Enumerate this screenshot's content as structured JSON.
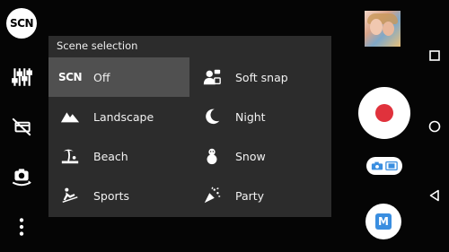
{
  "left_rail": {
    "scn_badge": "SCN",
    "icons": [
      "settings-sliders-icon",
      "flash-off-icon",
      "switch-camera-icon",
      "more-options-icon"
    ]
  },
  "scene_panel": {
    "title": "Scene selection",
    "selected": "Off",
    "items": [
      {
        "label": "Off",
        "icon": "scn-text-icon",
        "icon_text": "SCN"
      },
      {
        "label": "Soft snap",
        "icon": "soft-snap-icon"
      },
      {
        "label": "Landscape",
        "icon": "landscape-icon"
      },
      {
        "label": "Night",
        "icon": "night-icon"
      },
      {
        "label": "Beach",
        "icon": "beach-icon"
      },
      {
        "label": "Snow",
        "icon": "snow-icon"
      },
      {
        "label": "Sports",
        "icon": "sports-icon"
      },
      {
        "label": "Party",
        "icon": "party-icon"
      }
    ]
  },
  "right_controls": {
    "thumbnail": "last-photo-thumbnail",
    "record_button": "record-button",
    "mode_switch": "photo-video-switch",
    "manual_mode": "M"
  },
  "colors": {
    "panel_bg": "#2c2c2c",
    "selected_bg": "#505050",
    "record_red": "#e0323c",
    "manual_blue": "#3a8ee0"
  },
  "nav_bar": [
    "recents-square-icon",
    "home-circle-icon",
    "back-triangle-icon"
  ]
}
